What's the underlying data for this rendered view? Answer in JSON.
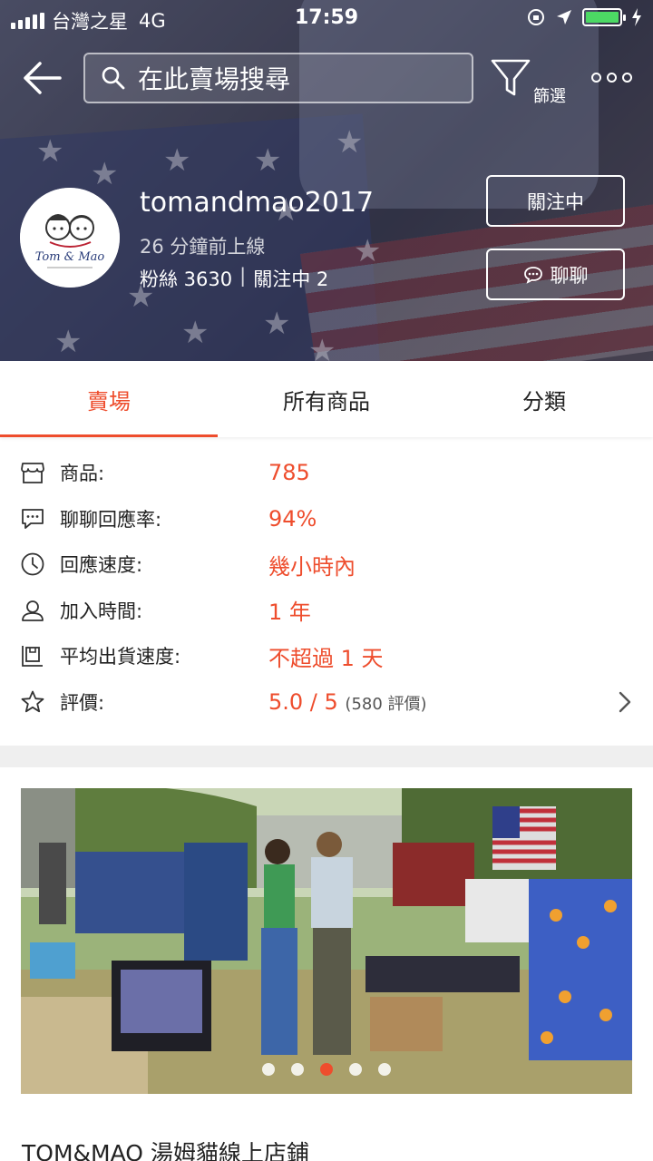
{
  "status_bar": {
    "carrier": "台灣之星",
    "network": "4G",
    "time": "17:59"
  },
  "header": {
    "search_placeholder": "在此賣場搜尋",
    "filter_label": "篩選"
  },
  "shop": {
    "username": "tomandmao2017",
    "last_online": "26 分鐘前上線",
    "followers": "粉絲 3630",
    "following": "關注中 2",
    "avatar_logo_text": "Tom & Mao",
    "follow_button": "關注中",
    "chat_button": "聊聊"
  },
  "tabs": [
    {
      "label": "賣場",
      "active": true
    },
    {
      "label": "所有商品",
      "active": false
    },
    {
      "label": "分類",
      "active": false
    }
  ],
  "stats": {
    "products": {
      "label": "商品:",
      "value": "785",
      "icon": "store-icon"
    },
    "chat_rate": {
      "label": "聊聊回應率:",
      "value": "94%",
      "icon": "chat-bubble-icon"
    },
    "response_speed": {
      "label": "回應速度:",
      "value": "幾小時內",
      "icon": "clock-icon"
    },
    "joined": {
      "label": "加入時間:",
      "value": "1 年",
      "icon": "user-icon"
    },
    "ship_speed": {
      "label": "平均出貨速度:",
      "value": "不超過 1 天",
      "icon": "shipping-box-icon"
    },
    "rating": {
      "label": "評價:",
      "value": "5.0 / 5",
      "count": "(580 評價)",
      "icon": "star-icon"
    }
  },
  "banner": {
    "slide_count": 5,
    "active_slide": 3
  },
  "shop_title": "TOM&MAO 湯姆貓線上店鋪",
  "colors": {
    "accent": "#ee4d2d",
    "divider": "#efefef",
    "battery": "#4cd964"
  }
}
